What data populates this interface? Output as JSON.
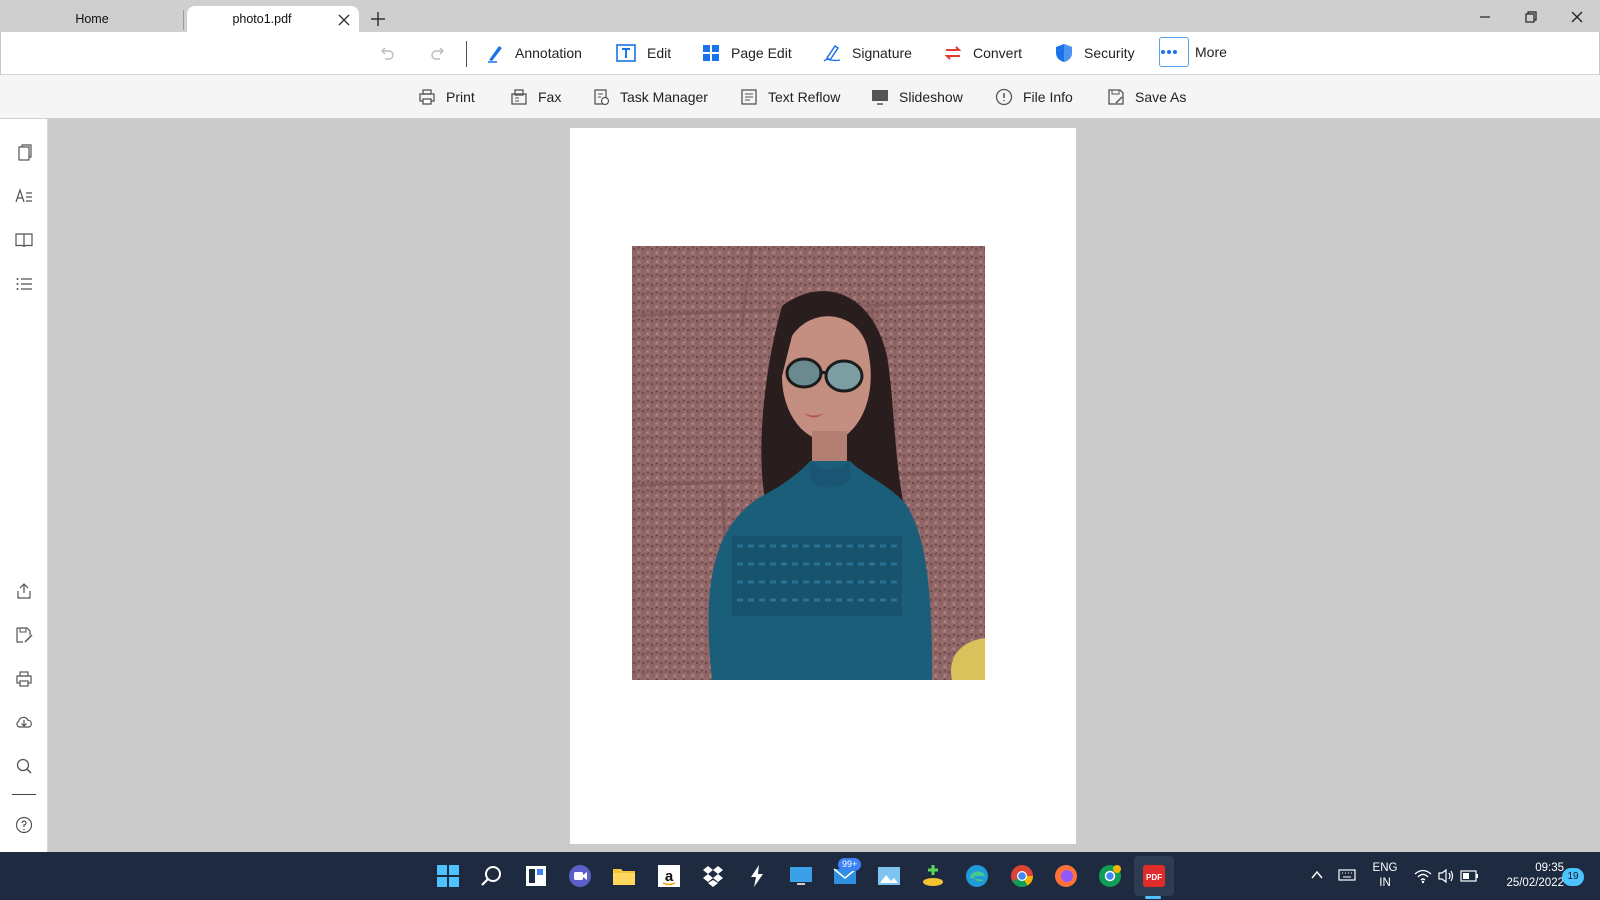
{
  "tabs": {
    "home_label": "Home",
    "doc_label": "photo1.pdf"
  },
  "ribbon_main": {
    "annotation": "Annotation",
    "edit": "Edit",
    "page_edit": "Page Edit",
    "signature": "Signature",
    "convert": "Convert",
    "security": "Security",
    "more": "More"
  },
  "ribbon_sub": {
    "print": "Print",
    "fax": "Fax",
    "task_manager": "Task Manager",
    "text_reflow": "Text Reflow",
    "slideshow": "Slideshow",
    "file_info": "File Info",
    "save_as": "Save As"
  },
  "taskbar": {
    "mail_badge": "99+",
    "language_line1": "ENG",
    "language_line2": "IN",
    "time": "09:35",
    "date": "25/02/2022",
    "notifications": "19"
  },
  "colors": {
    "accent": "#1a73e8",
    "convert_red": "#e33b2e",
    "taskbar": "#1d2a3f",
    "photo_top": "#8a5f5f",
    "shirt": "#1b5e7a"
  },
  "icons": {
    "rail_top": [
      "pages-icon",
      "text-recognize-icon",
      "bookmark-icon",
      "outline-list-icon"
    ],
    "rail_bottom": [
      "share-icon",
      "save-edit-icon",
      "print-icon",
      "cloud-icon",
      "search-icon",
      "help-icon"
    ]
  }
}
